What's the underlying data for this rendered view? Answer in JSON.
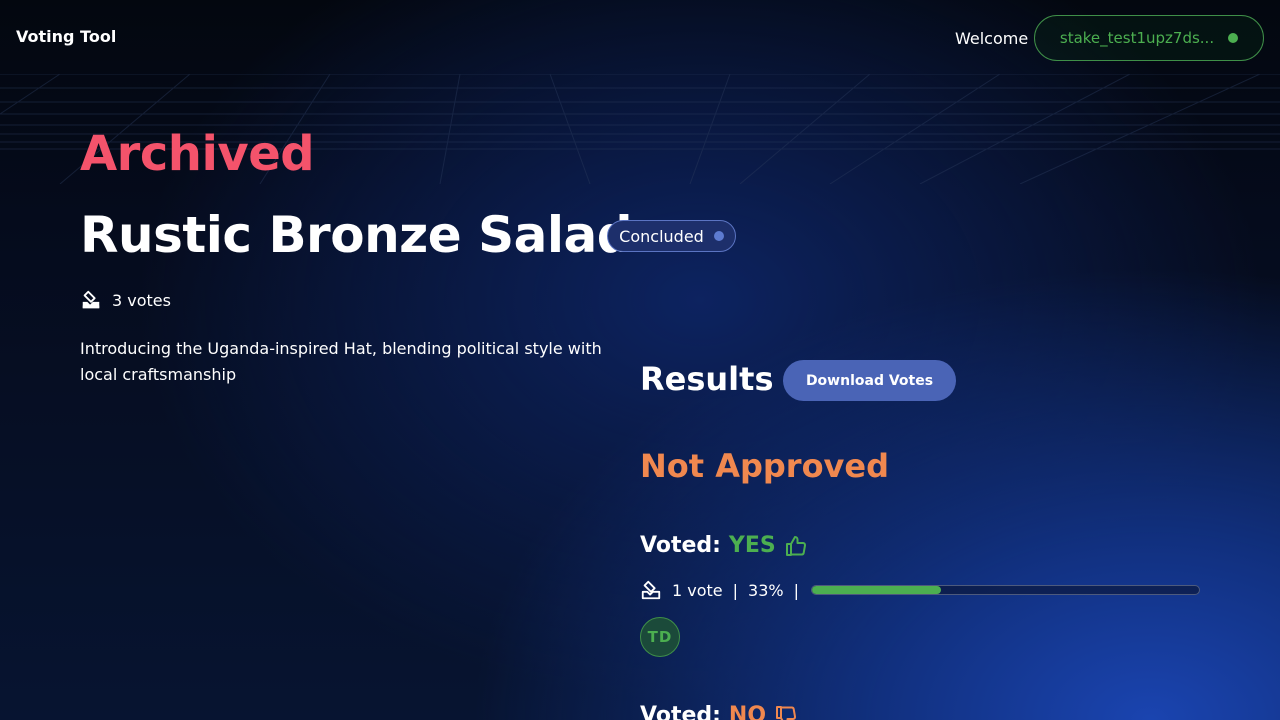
{
  "header": {
    "brand": "Voting Tool",
    "welcome": "Welcome",
    "wallet_address": "stake_test1upz7ds..."
  },
  "proposal": {
    "section_label": "Archived",
    "title": "Rustic Bronze Salad",
    "status": "Concluded",
    "votes_count_label": "3 votes",
    "description": "Introducing the Uganda-inspired Hat, blending political style with local craftsmanship"
  },
  "results": {
    "title": "Results",
    "download_label": "Download Votes",
    "outcome": "Not Approved",
    "yes": {
      "voted_label": "Voted:",
      "option": "YES",
      "count_label": "1 vote",
      "percent_label": "33%",
      "percent_value": 33.3,
      "voter_initials": "TD"
    },
    "no": {
      "voted_label": "Voted:",
      "option": "NO"
    }
  },
  "colors": {
    "accent_archived": "#f4536b",
    "yes_green": "#4caf50",
    "no_orange": "#f0884f",
    "button_blue": "#4a64b6"
  },
  "icons": {
    "ballot": "ballot-box-icon",
    "thumbs_up": "thumbs-up-icon",
    "thumbs_down": "thumbs-down-icon",
    "status_dot": "status-dot-icon"
  }
}
